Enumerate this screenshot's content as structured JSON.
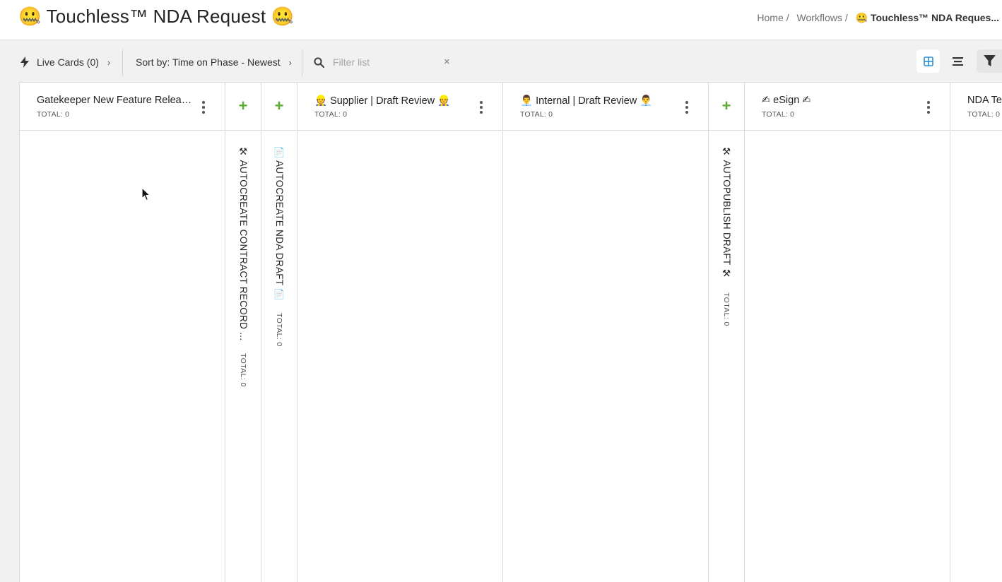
{
  "header": {
    "title": "🤐 Touchless™ NDA Request 🤐",
    "breadcrumb": {
      "home": "Home",
      "workflows": "Workflows",
      "current": "🤐 Touchless™ NDA Reques..."
    }
  },
  "toolbar": {
    "live_cards": "Live Cards (0)",
    "sort": "Sort by: Time on Phase - Newest",
    "filter_placeholder": "Filter list",
    "clear": "×"
  },
  "columns": [
    {
      "title": "Gatekeeper New Feature Releas...",
      "total": "TOTAL: 0"
    },
    {
      "title": "⚒ AUTOCREATE CONTRACT RECORD ...",
      "total": "TOTAL: 0",
      "collapsed": true
    },
    {
      "title": "📄 AUTOCREATE NDA DRAFT 📄",
      "total": "TOTAL: 0",
      "collapsed": true
    },
    {
      "title": "👷 Supplier | Draft Review 👷",
      "total": "TOTAL: 0"
    },
    {
      "title": "👨‍💼 Internal | Draft Review 👨‍💼",
      "total": "TOTAL: 0"
    },
    {
      "title": "⚒ AUTOPUBLISH DRAFT ⚒",
      "total": "TOTAL: 0",
      "collapsed": true
    },
    {
      "title": "✍ eSign ✍",
      "total": "TOTAL: 0"
    },
    {
      "title": "NDA Te",
      "total": "TOTAL: 0"
    }
  ],
  "icons": {
    "bolt": "bolt-icon",
    "search": "search-icon",
    "grid_view": "grid-view-icon",
    "list_view": "list-view-icon",
    "filter": "filter-icon",
    "add": "plus-icon",
    "kebab": "kebab-icon"
  },
  "colors": {
    "accent_blue": "#2b8fd6",
    "plus_green": "#5aab2e"
  }
}
